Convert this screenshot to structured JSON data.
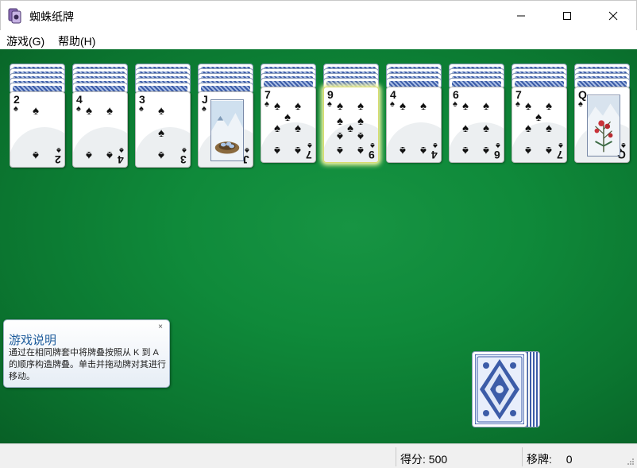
{
  "window": {
    "title": "蜘蛛纸牌"
  },
  "menu": {
    "game": "游戏(G)",
    "help": "帮助(H)"
  },
  "piles": [
    {
      "rank": "2",
      "suit": "♠",
      "backs": 5
    },
    {
      "rank": "4",
      "suit": "♠",
      "backs": 5
    },
    {
      "rank": "3",
      "suit": "♠",
      "backs": 5
    },
    {
      "rank": "J",
      "suit": "♠",
      "backs": 5
    },
    {
      "rank": "7",
      "suit": "♠",
      "backs": 4
    },
    {
      "rank": "9",
      "suit": "♠",
      "backs": 4,
      "selected": true
    },
    {
      "rank": "4",
      "suit": "♠",
      "backs": 4
    },
    {
      "rank": "6",
      "suit": "♠",
      "backs": 4
    },
    {
      "rank": "7",
      "suit": "♠",
      "backs": 4
    },
    {
      "rank": "Q",
      "suit": "♠",
      "backs": 4
    }
  ],
  "stock": {
    "deals_remaining": 5
  },
  "tip": {
    "title": "游戏说明",
    "body": "通过在相同牌套中将牌叠按照从 K 到 A 的顺序构造牌叠。单击并拖动牌对其进行移动。",
    "close": "×"
  },
  "status": {
    "score_label": "得分:",
    "score": "500",
    "moves_label": "移牌:",
    "moves": "0"
  },
  "colors": {
    "felt": "#0f8a3a",
    "tip_title": "#1f5d9c",
    "card_back": "#3c5ca8"
  }
}
